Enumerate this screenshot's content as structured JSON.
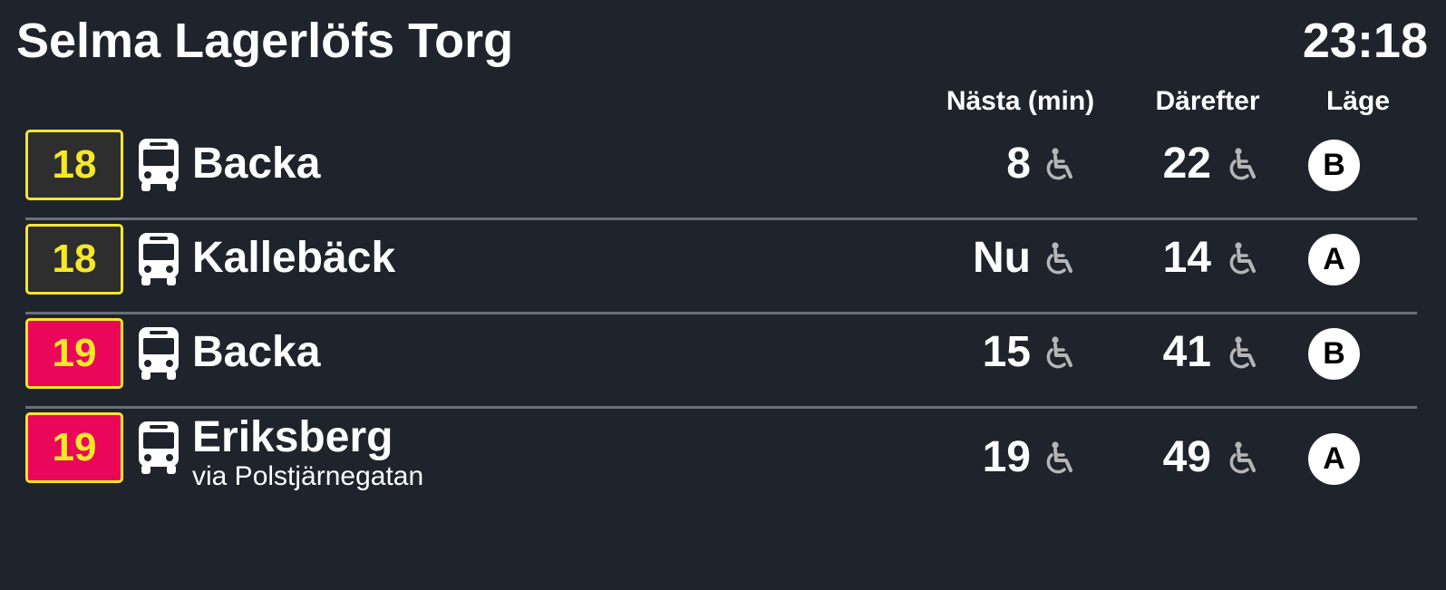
{
  "header": {
    "stop_name": "Selma Lagerlöfs Torg",
    "clock": "23:18"
  },
  "columns": {
    "next": "Nästa (min)",
    "after": "Därefter",
    "position": "Läge"
  },
  "colors": {
    "background": "#1f232b",
    "line_18_bg": "#2e2e2e",
    "line_19_bg": "#ea0659",
    "line_text": "#f6e72a",
    "divider": "#6b6f78",
    "accessibility_icon": "#b5b5b5"
  },
  "departures": [
    {
      "line": "18",
      "line_bg": "#2e2e2e",
      "vehicle_icon": "bus-icon",
      "destination": "Backa",
      "via": "",
      "next": "8",
      "next_accessible": true,
      "after": "22",
      "after_accessible": true,
      "position": "B"
    },
    {
      "line": "18",
      "line_bg": "#2e2e2e",
      "vehicle_icon": "bus-icon",
      "destination": "Kallebäck",
      "via": "",
      "next": "Nu",
      "next_accessible": true,
      "after": "14",
      "after_accessible": true,
      "position": "A"
    },
    {
      "line": "19",
      "line_bg": "#ea0659",
      "vehicle_icon": "bus-icon",
      "destination": "Backa",
      "via": "",
      "next": "15",
      "next_accessible": true,
      "after": "41",
      "after_accessible": true,
      "position": "B"
    },
    {
      "line": "19",
      "line_bg": "#ea0659",
      "vehicle_icon": "bus-icon",
      "destination": "Eriksberg",
      "via": "via Polstjärnegatan",
      "next": "19",
      "next_accessible": true,
      "after": "49",
      "after_accessible": true,
      "position": "A"
    }
  ]
}
